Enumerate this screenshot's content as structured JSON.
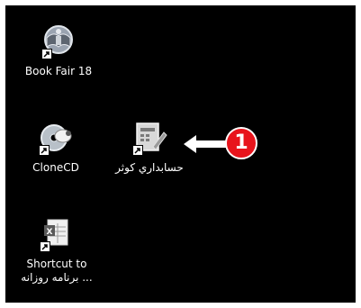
{
  "desktop": {
    "background": "#000000",
    "icons": [
      {
        "label": "Book Fair 18",
        "icon": "globe-book-icon"
      },
      {
        "label": "CloneCD",
        "icon": "cd-sheep-icon"
      },
      {
        "label": "حسابداري کوثر",
        "icon": "accounting-doc-icon"
      },
      {
        "label_line1": "Shortcut to",
        "label_line2": "... برنامه روزانه",
        "icon": "excel-file-icon"
      }
    ]
  },
  "callout": {
    "number": "1",
    "color": "#e8141c"
  }
}
